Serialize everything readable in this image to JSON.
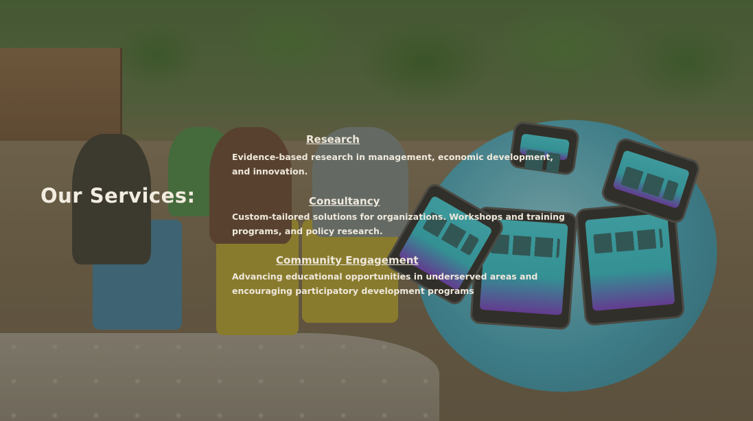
{
  "section": {
    "heading": "Our Services:"
  },
  "services": [
    {
      "title": "Research",
      "description_lines": [
        " Evidence-based research in management, economic development,",
        "and innovation."
      ]
    },
    {
      "title": "Consultancy",
      "description_lines": [
        " Custom-tailored solutions for organizations. Workshops and training",
        "programs, and policy research."
      ]
    },
    {
      "title": "Community Engagement",
      "description_lines": [
        "Advancing educational opportunities in underserved areas and",
        "encouraging participatory development programs"
      ]
    }
  ],
  "colors": {
    "text": "#efe8dc",
    "overlay": "rgba(60,55,40,0.38)"
  }
}
